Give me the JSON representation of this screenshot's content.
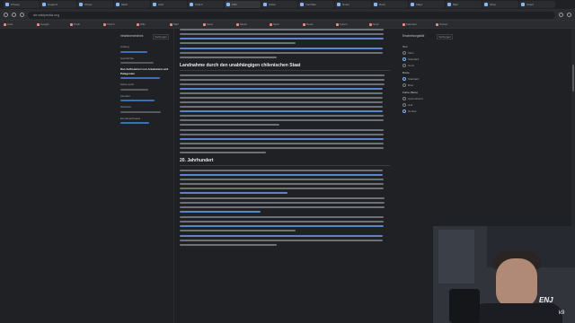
{
  "browser": {
    "tabs": [
      {
        "label": "Privacy",
        "active": false
      },
      {
        "label": "Liegend",
        "active": false
      },
      {
        "label": "Chess",
        "active": false
      },
      {
        "label": "Mesh",
        "active": false
      },
      {
        "label": "Auto",
        "active": false
      },
      {
        "label": "Twitch",
        "active": false
      },
      {
        "label": "Wiki",
        "active": true
      },
      {
        "label": "Arbeit",
        "active": false
      },
      {
        "label": "YouTube",
        "active": false
      },
      {
        "label": "Notes",
        "active": false
      },
      {
        "label": "Docs",
        "active": false
      },
      {
        "label": "Maps",
        "active": false
      },
      {
        "label": "Mail",
        "active": false
      },
      {
        "label": "Shop",
        "active": false
      },
      {
        "label": "Cloud",
        "active": false
      }
    ],
    "address": "de.wikipedia.org",
    "bookmarks": [
      "Liste",
      "Google",
      "Profil",
      "Twitch",
      "Wiki",
      "Mail",
      "Karte",
      "Musik",
      "Spiel",
      "News",
      "Forum",
      "Notiz",
      "Kalender",
      "Ordner"
    ]
  },
  "toc": {
    "title": "Inhaltsverzeichnis",
    "hide_label": "Verbergen",
    "items": [
      {
        "label": "Anfang"
      },
      {
        "label": "Geschichte"
      },
      {
        "label": "Das Aufkommen von Araukanien und Patagonien",
        "current": true
      },
      {
        "label": "Siehe auch"
      },
      {
        "label": "Literatur"
      },
      {
        "label": "Weblinks"
      },
      {
        "label": "Einzelnachweise"
      }
    ]
  },
  "article": {
    "heading_1": "Landnahme durch den unabhängigen chilenischen Staat",
    "heading_2": "20. Jahrhundert"
  },
  "sidebar": {
    "title": "Erscheinungsbild",
    "hide_label": "Verbergen",
    "text_group": "Text",
    "text_options": [
      "Klein",
      "Standard",
      "Groß"
    ],
    "width_group": "Breite",
    "width_options": [
      "Standard",
      "Breit"
    ],
    "color_group": "Farbe (Beta)",
    "color_options": [
      "Automatisch",
      "Hell",
      "Dunkel"
    ]
  },
  "stream": {
    "logo": "ENJ",
    "badge": "k9"
  }
}
